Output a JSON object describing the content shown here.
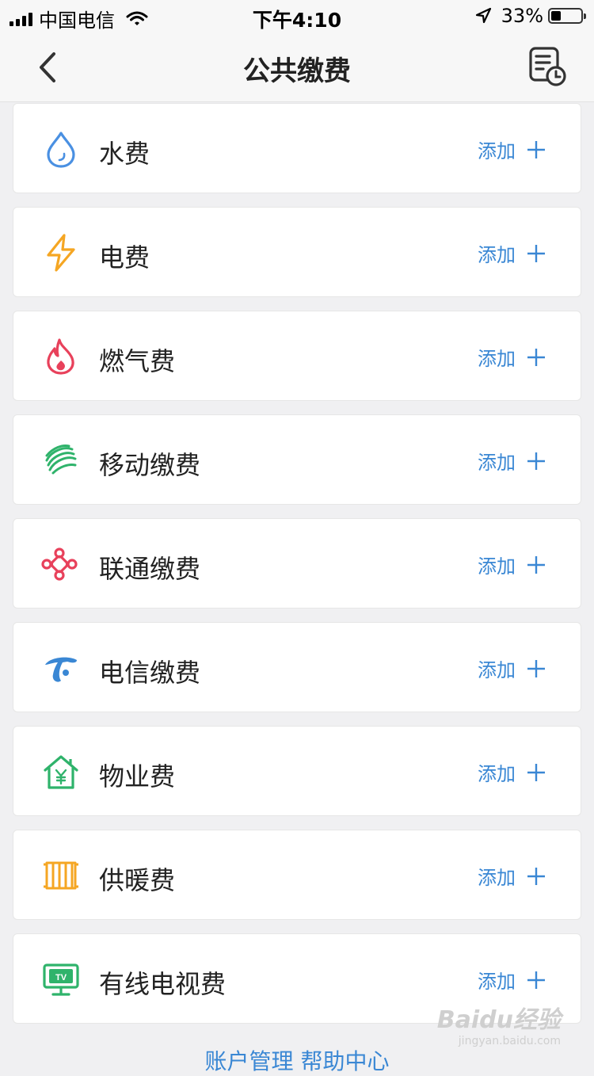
{
  "status_bar": {
    "carrier": "中国电信",
    "time": "下午4:10",
    "battery": "33%",
    "battery_level": 0.33
  },
  "nav": {
    "title": "公共缴费",
    "back_icon": "chevron-left-icon",
    "history_icon": "bill-history-icon"
  },
  "add_label": "添加",
  "items": [
    {
      "label": "水费",
      "icon": "water-drop-icon",
      "color": "#4a90e2"
    },
    {
      "label": "电费",
      "icon": "lightning-icon",
      "color": "#f5a623"
    },
    {
      "label": "燃气费",
      "icon": "flame-icon",
      "color": "#e8415b"
    },
    {
      "label": "移动缴费",
      "icon": "china-mobile-icon",
      "color": "#2fb36b"
    },
    {
      "label": "联通缴费",
      "icon": "china-unicom-icon",
      "color": "#e8415b"
    },
    {
      "label": "电信缴费",
      "icon": "china-telecom-icon",
      "color": "#3a87d4"
    },
    {
      "label": "物业费",
      "icon": "house-yen-icon",
      "color": "#2fb36b"
    },
    {
      "label": "供暖费",
      "icon": "radiator-icon",
      "color": "#f5a623"
    },
    {
      "label": "有线电视费",
      "icon": "tv-icon",
      "color": "#2fb36b",
      "tv_text": "TV"
    }
  ],
  "footer": {
    "links_text": "账户管理 帮助中心"
  },
  "watermark": {
    "brand": "Baidu经验",
    "url": "jingyan.baidu.com"
  },
  "accent_color": "#3a87d4"
}
